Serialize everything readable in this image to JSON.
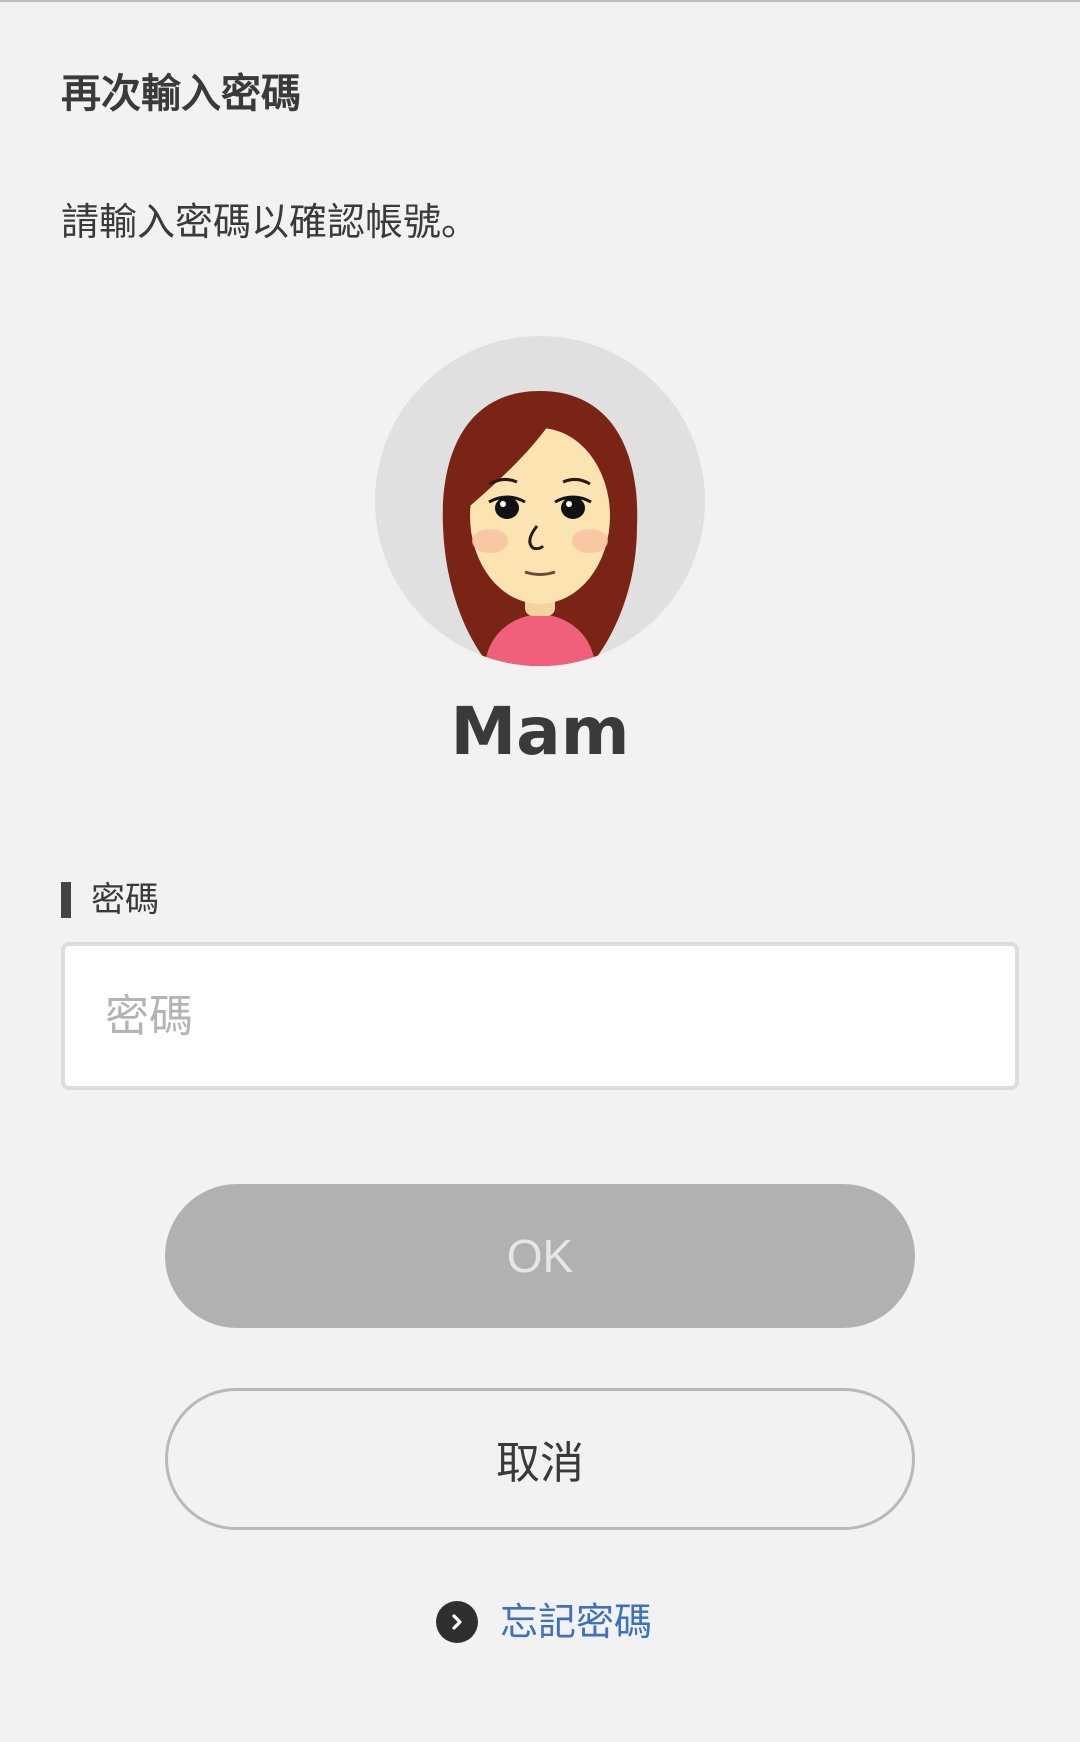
{
  "header": {
    "title": "再次輸入密碼"
  },
  "main": {
    "instruction": "請輸入密碼以確認帳號。",
    "user": {
      "name": "Mam"
    },
    "password": {
      "label": "密碼",
      "placeholder": "密碼",
      "value": ""
    },
    "ok_label": "OK",
    "cancel_label": "取消",
    "forgot_label": "忘記密碼"
  },
  "icons": {
    "avatar": "mii-avatar-icon",
    "forgot": "chevron-right-circle-icon"
  },
  "colors": {
    "background": "#f2f2f2",
    "ok_button_disabled": "#b1b1b1",
    "link": "#3f6fc0"
  }
}
